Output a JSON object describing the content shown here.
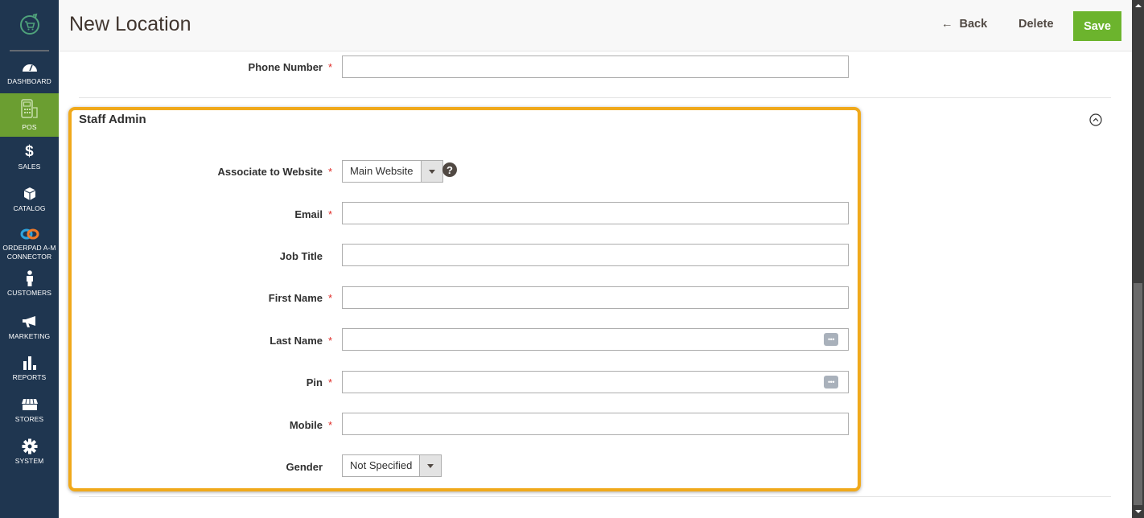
{
  "header": {
    "title": "New Location",
    "back_label": "Back",
    "delete_label": "Delete",
    "save_label": "Save"
  },
  "sidebar": {
    "logo": "pos-cart-logo",
    "items": [
      {
        "label": "DASHBOARD",
        "icon": "dashboard-icon"
      },
      {
        "label": "POS",
        "icon": "pos-terminal-icon",
        "active": true
      },
      {
        "label": "SALES",
        "icon": "dollar-icon"
      },
      {
        "label": "CATALOG",
        "icon": "box-icon"
      },
      {
        "label": "ORDERPAD A-M CONNECTOR",
        "label_line1": "ORDERPAD A-M",
        "label_line2": "CONNECTOR",
        "icon": "link-icon"
      },
      {
        "label": "CUSTOMERS",
        "icon": "person-icon"
      },
      {
        "label": "MARKETING",
        "icon": "megaphone-icon"
      },
      {
        "label": "REPORTS",
        "icon": "bar-chart-icon"
      },
      {
        "label": "STORES",
        "icon": "store-icon"
      },
      {
        "label": "SYSTEM",
        "icon": "gear-icon"
      }
    ]
  },
  "form": {
    "phone_number": {
      "label": "Phone Number",
      "required": "*",
      "value": ""
    },
    "section": {
      "title": "Staff Admin"
    },
    "associate_website": {
      "label": "Associate to Website",
      "required": "*",
      "selected": "Main Website",
      "help": "?"
    },
    "email": {
      "label": "Email",
      "required": "*",
      "value": ""
    },
    "job_title": {
      "label": "Job Title",
      "value": ""
    },
    "first_name": {
      "label": "First Name",
      "required": "*",
      "value": ""
    },
    "last_name": {
      "label": "Last Name",
      "required": "*",
      "value": ""
    },
    "pin": {
      "label": "Pin",
      "required": "*",
      "value": ""
    },
    "mobile": {
      "label": "Mobile",
      "required": "*",
      "value": ""
    },
    "gender": {
      "label": "Gender",
      "selected": "Not Specified"
    }
  },
  "colors": {
    "sidebar_bg": "#1f3650",
    "active_nav": "#6b9e31",
    "save_button": "#6cb42d",
    "highlight_border": "#f0a91b",
    "required_star": "#e02b27"
  }
}
